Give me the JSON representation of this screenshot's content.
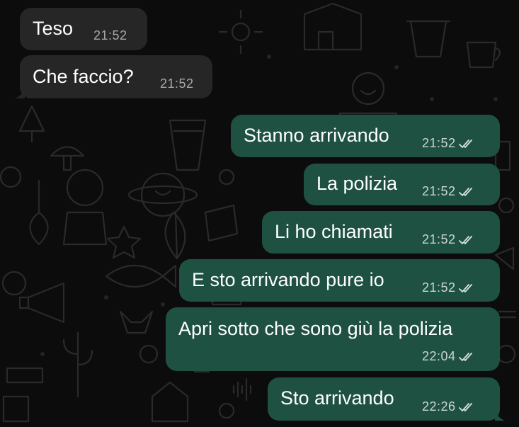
{
  "chat": {
    "incoming": [
      {
        "text": "Teso",
        "time": "21:52"
      },
      {
        "text": "Che faccio?",
        "time": "21:52"
      }
    ],
    "outgoing": [
      {
        "text": "Stanno arrivando",
        "time": "21:52",
        "status": "read"
      },
      {
        "text": "La polizia",
        "time": "21:52",
        "status": "read"
      },
      {
        "text": "Li ho chiamati",
        "time": "21:52",
        "status": "read"
      },
      {
        "text": "E sto arrivando pure io",
        "time": "21:52",
        "status": "read"
      },
      {
        "text": "Apri sotto che sono giù la polizia",
        "time": "22:04",
        "status": "read"
      },
      {
        "text": "Sto arrivando",
        "time": "22:26",
        "status": "read"
      }
    ]
  },
  "icons": {
    "read_status": "double-check-icon"
  },
  "colors": {
    "background": "#0c0c0c",
    "incoming_bubble": "#262626",
    "outgoing_bubble": "#1e5141",
    "text": "#ffffff"
  }
}
